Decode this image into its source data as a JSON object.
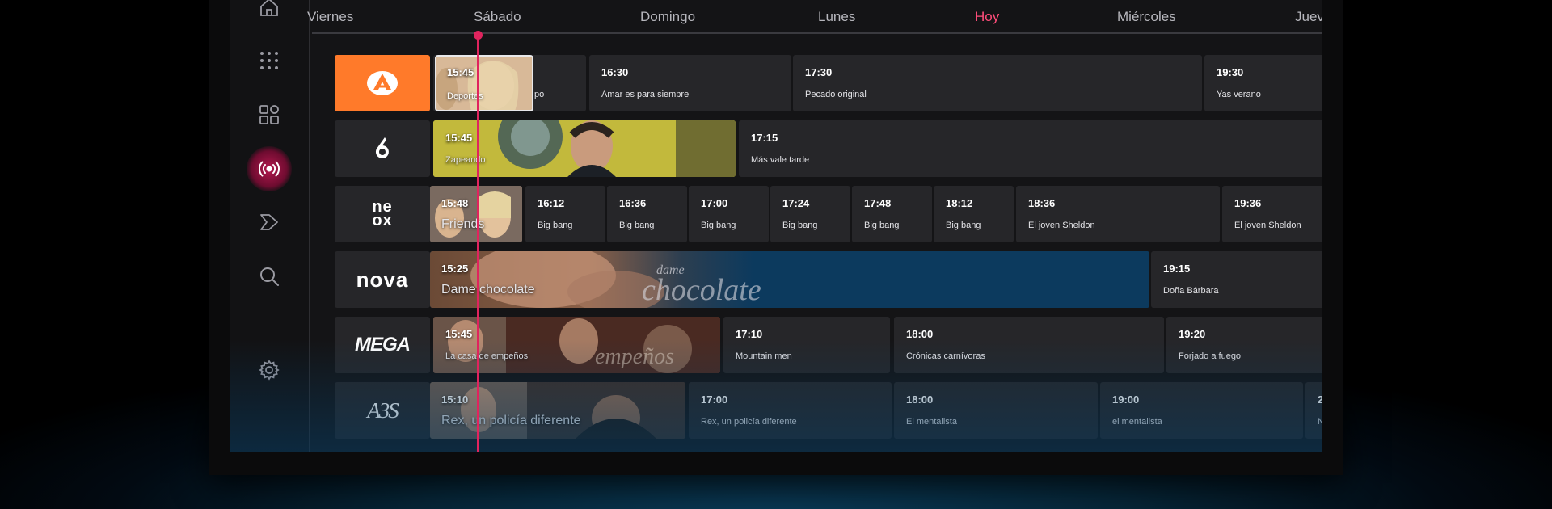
{
  "days": [
    {
      "label": "Viernes",
      "active": false
    },
    {
      "label": "Sábado",
      "active": false
    },
    {
      "label": "Domingo",
      "active": false
    },
    {
      "label": "Lunes",
      "active": false
    },
    {
      "label": "Hoy",
      "active": true
    },
    {
      "label": "Miércoles",
      "active": false
    },
    {
      "label": "Jueves",
      "active": false
    }
  ],
  "sidebar": {
    "items": [
      {
        "icon": "home-icon"
      },
      {
        "icon": "apps-grid-icon"
      },
      {
        "icon": "categories-icon"
      },
      {
        "icon": "live-broadcast-icon",
        "active": true
      },
      {
        "icon": "play-forward-icon"
      },
      {
        "icon": "search-icon"
      },
      {
        "icon": "settings-icon"
      }
    ]
  },
  "colors": {
    "accent": "#e0245e",
    "antena3": "#ff7a2a",
    "card": "#262629"
  },
  "channels": [
    {
      "name": "Antena 3",
      "programs": [
        {
          "time": "15:45",
          "title": "Deportes",
          "title_tail": "po"
        },
        {
          "time": "16:30",
          "title": "Amar es para siempre"
        },
        {
          "time": "17:30",
          "title": "Pecado original"
        },
        {
          "time": "19:30",
          "title": "Yas verano"
        }
      ]
    },
    {
      "name": "laSexta",
      "programs": [
        {
          "time": "15:45",
          "title": "Zapeando"
        },
        {
          "time": "17:15",
          "title": "Más vale tarde"
        }
      ]
    },
    {
      "name": "Neox",
      "logo_text": [
        "ne",
        "ox"
      ],
      "programs": [
        {
          "time": "15:48",
          "title": "Friends"
        },
        {
          "time": "16:12",
          "title": "Big bang"
        },
        {
          "time": "16:36",
          "title": "Big bang"
        },
        {
          "time": "17:00",
          "title": "Big bang"
        },
        {
          "time": "17:24",
          "title": "Big bang"
        },
        {
          "time": "17:48",
          "title": "Big bang"
        },
        {
          "time": "18:12",
          "title": "Big bang"
        },
        {
          "time": "18:36",
          "title": "El joven Sheldon"
        },
        {
          "time": "19:36",
          "title": "El joven Sheldon"
        }
      ]
    },
    {
      "name": "Nova",
      "logo_text": "nova",
      "programs": [
        {
          "time": "15:25",
          "title": "Dame chocolate",
          "art": [
            "dame",
            "chocolate"
          ]
        },
        {
          "time": "19:15",
          "title": "Doña Bárbara"
        }
      ]
    },
    {
      "name": "Mega",
      "logo_text": "MEGA",
      "programs": [
        {
          "time": "15:45",
          "title": "La casa de empeños",
          "art": "empeños"
        },
        {
          "time": "17:10",
          "title": "Mountain men"
        },
        {
          "time": "18:00",
          "title": "Crónicas carnívoras"
        },
        {
          "time": "19:20",
          "title": "Forjado a fuego"
        }
      ]
    },
    {
      "name": "A3S",
      "logo_text": "A3S",
      "programs": [
        {
          "time": "15:10",
          "title": "Rex, un policía diferente"
        },
        {
          "time": "17:00",
          "title": "Rex, un policía diferente"
        },
        {
          "time": "18:00",
          "title": "El mentalista"
        },
        {
          "time": "19:00",
          "title": "el mentalista"
        },
        {
          "time": "2",
          "title": "N"
        }
      ]
    }
  ]
}
